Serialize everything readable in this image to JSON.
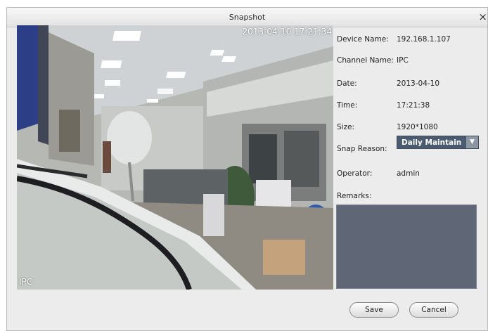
{
  "window": {
    "title": "Snapshot",
    "close_glyph": "×"
  },
  "snapshot": {
    "timestamp": "2013-04-10 17:21:34",
    "channel_overlay": "IPC"
  },
  "info": {
    "device_name_label": "Device Name:",
    "device_name_value": "192.168.1.107",
    "channel_name_label": "Channel Name:",
    "channel_name_value": "IPC",
    "date_label": "Date:",
    "date_value": "2013-04-10",
    "time_label": "Time:",
    "time_value": "17:21:38",
    "size_label": "Size:",
    "size_value": "1920*1080",
    "snap_reason_label": "Snap Reason:",
    "snap_reason_value": "Daily Maintain",
    "operator_label": "Operator:",
    "operator_value": "admin",
    "remarks_label": "Remarks:",
    "remarks_value": ""
  },
  "buttons": {
    "save": "Save",
    "cancel": "Cancel"
  },
  "colors": {
    "dialog_bg": "#ececec",
    "select_bg": "#4b5b6f",
    "remarks_bg": "#5f6675"
  }
}
